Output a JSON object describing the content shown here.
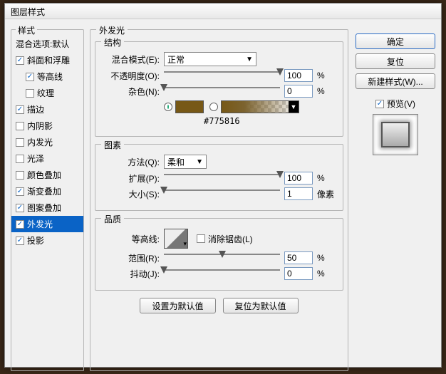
{
  "window": {
    "title": "图层样式"
  },
  "styles": {
    "header": "样式",
    "subheader": "混合选项:默认",
    "items": [
      {
        "label": "斜面和浮雕",
        "checked": true,
        "indent": 0
      },
      {
        "label": "等高线",
        "checked": true,
        "indent": 1
      },
      {
        "label": "纹理",
        "checked": false,
        "indent": 1
      },
      {
        "label": "描边",
        "checked": true,
        "indent": 0
      },
      {
        "label": "内阴影",
        "checked": false,
        "indent": 0
      },
      {
        "label": "内发光",
        "checked": false,
        "indent": 0
      },
      {
        "label": "光泽",
        "checked": false,
        "indent": 0
      },
      {
        "label": "颜色叠加",
        "checked": false,
        "indent": 0
      },
      {
        "label": "渐变叠加",
        "checked": true,
        "indent": 0
      },
      {
        "label": "图案叠加",
        "checked": true,
        "indent": 0
      },
      {
        "label": "外发光",
        "checked": true,
        "indent": 0,
        "selected": true
      },
      {
        "label": "投影",
        "checked": true,
        "indent": 0
      }
    ]
  },
  "panel": {
    "title": "外发光",
    "structure": {
      "title": "结构",
      "blend_label": "混合模式(E):",
      "blend_value": "正常",
      "opacity_label": "不透明度(O):",
      "opacity_value": "100",
      "opacity_unit": "%",
      "noise_label": "杂色(N):",
      "noise_value": "0",
      "noise_unit": "%",
      "color_hex": "#775816"
    },
    "elements": {
      "title": "图素",
      "method_label": "方法(Q):",
      "method_value": "柔和",
      "spread_label": "扩展(P):",
      "spread_value": "100",
      "spread_unit": "%",
      "size_label": "大小(S):",
      "size_value": "1",
      "size_unit": "像素"
    },
    "quality": {
      "title": "品质",
      "contour_label": "等高线:",
      "antialias_label": "消除锯齿(L)",
      "range_label": "范围(R):",
      "range_value": "50",
      "range_unit": "%",
      "jitter_label": "抖动(J):",
      "jitter_value": "0",
      "jitter_unit": "%"
    },
    "buttons": {
      "set_default": "设置为默认值",
      "reset_default": "复位为默认值"
    }
  },
  "right": {
    "ok": "确定",
    "cancel": "复位",
    "new_style": "新建样式(W)...",
    "preview_label": "预览(V)"
  }
}
